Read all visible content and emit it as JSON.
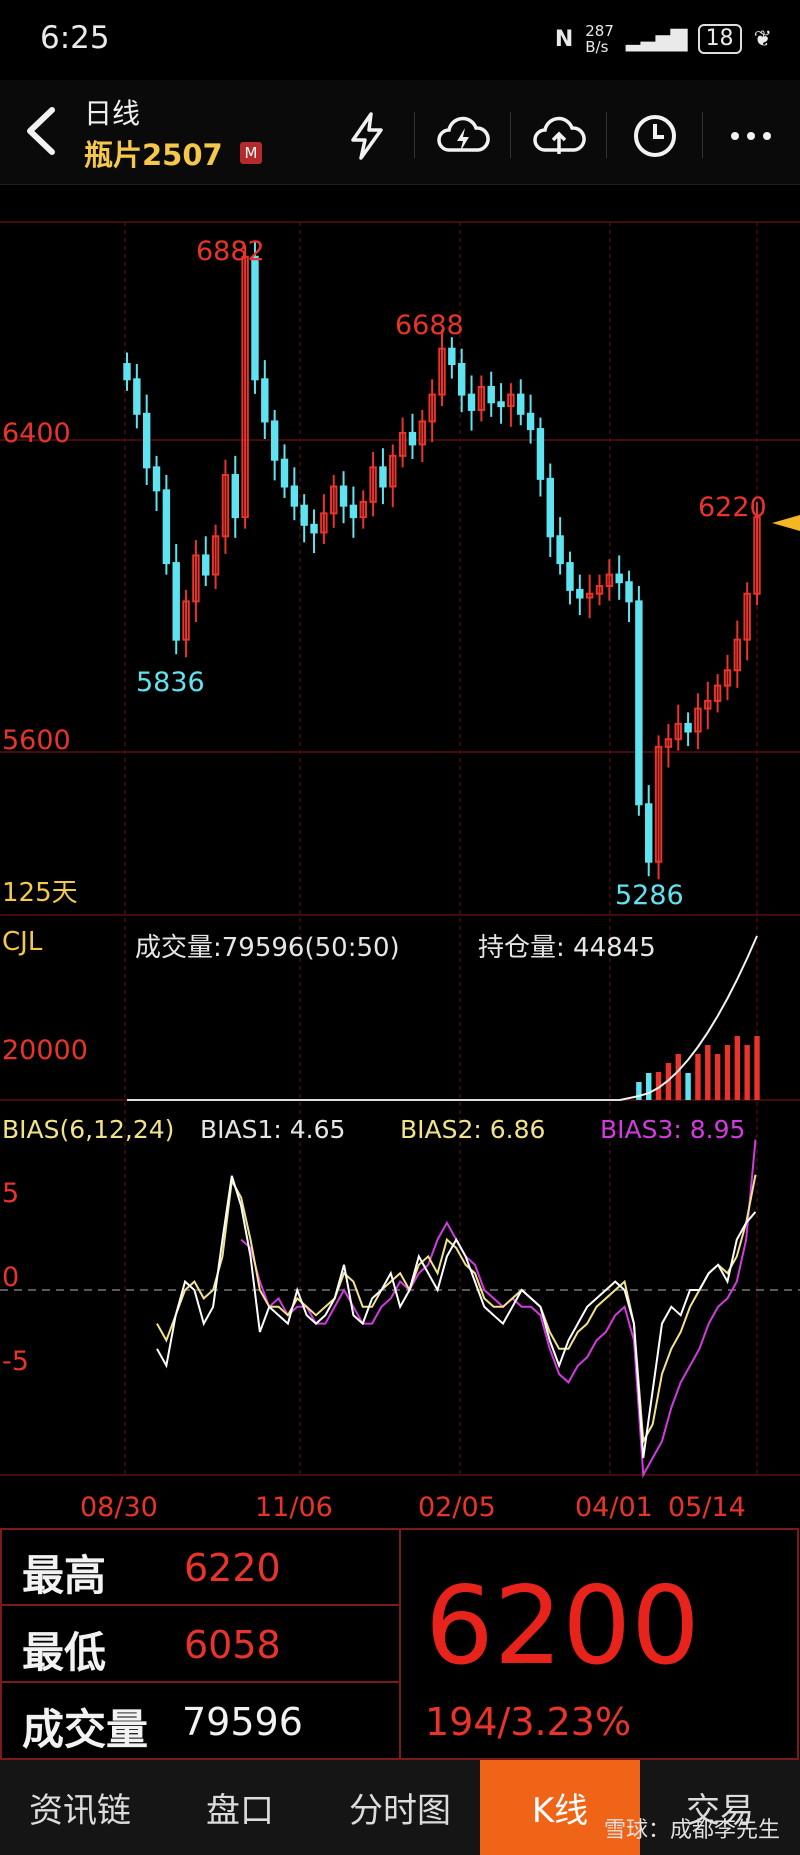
{
  "status": {
    "time": "6:25",
    "net_speed_top": "287",
    "net_speed_bottom": "B/s",
    "battery": "18"
  },
  "nav": {
    "subtitle": "日线",
    "title": "瓶片2507",
    "badge": "M"
  },
  "icons": [
    "back-icon",
    "flash-icon",
    "cloud-flash-icon",
    "cloud-upload-icon",
    "clock-icon",
    "more-icon"
  ],
  "price_panel": {
    "y_labels": [
      "6400",
      "5600"
    ],
    "high_label": "6882",
    "high2_label": "6688",
    "low_label": "5836",
    "low2_label": "5286",
    "last_label": "6220",
    "period": "125天"
  },
  "volume_panel": {
    "name": "CJL",
    "volume_text": "成交量:79596(50:50)",
    "oi_text": "持仓量: 44845",
    "y_label": "20000"
  },
  "bias_panel": {
    "name": "BIAS(6,12,24)",
    "bias1": "BIAS1: 4.65",
    "bias2": "BIAS2: 6.86",
    "bias3": "BIAS3: 8.95",
    "y_labels": [
      "5",
      "0",
      "-5"
    ]
  },
  "x_labels": [
    "08/30",
    "11/06",
    "02/05",
    "04/01",
    "05/14"
  ],
  "colors": {
    "up": "#e8342a",
    "down": "#5fe3f0",
    "bias1": "#ffffff",
    "bias2": "#f2e38a",
    "bias3": "#d23be0",
    "accent": "#f06417"
  },
  "chart_data": {
    "type": "candlestick",
    "panels": [
      "price",
      "volume",
      "bias"
    ],
    "price_range": [
      5200,
      6950
    ],
    "marked": {
      "high": 6882,
      "high2": 6688,
      "low": 5836,
      "low2": 5286,
      "last": 6220
    },
    "closes": [
      6560,
      6470,
      6330,
      6270,
      6080,
      5880,
      5980,
      6100,
      6050,
      6150,
      6310,
      6200,
      6880,
      6560,
      6450,
      6350,
      6280,
      6230,
      6180,
      6160,
      6210,
      6280,
      6230,
      6200,
      6240,
      6330,
      6280,
      6360,
      6420,
      6390,
      6450,
      6520,
      6640,
      6600,
      6520,
      6480,
      6540,
      6500,
      6490,
      6520,
      6470,
      6430,
      6300,
      6150,
      6080,
      6010,
      5990,
      6000,
      6020,
      6050,
      6030,
      5980,
      5450,
      5300,
      5600,
      5620,
      5660,
      5640,
      5700,
      5720,
      5760,
      5800,
      5880,
      6000,
      6200
    ],
    "bias1": [
      -3.5,
      -4.5,
      -1.5,
      0.5,
      0,
      -2,
      -1,
      3,
      6.8,
      5,
      2,
      -2.5,
      -1,
      -1.5,
      -2,
      0,
      -1.5,
      -2,
      -1.5,
      -0.5,
      1.5,
      -1.5,
      -2,
      -0.5,
      0,
      1,
      -1,
      0,
      2,
      1,
      0,
      2,
      3,
      2,
      0.5,
      -1,
      -1.5,
      -2,
      -1,
      0,
      -0.5,
      -1,
      -3,
      -4.5,
      -3,
      -2,
      -1,
      -0.5,
      0,
      0.5,
      0,
      -2,
      -10,
      -6,
      -2,
      -1,
      -1.5,
      0,
      0,
      1,
      1.5,
      0.5,
      3,
      4,
      4.65
    ],
    "bias2": [
      -2,
      -3,
      -1.5,
      0,
      0.5,
      -0.5,
      0,
      2,
      6.5,
      5.5,
      3,
      0,
      -1,
      -1,
      -1.5,
      -0.5,
      -1,
      -1.5,
      -1,
      -0.5,
      1,
      0.5,
      -1,
      -1,
      0,
      0.5,
      1,
      0,
      1.5,
      2,
      1,
      3,
      2.5,
      1.5,
      1,
      -0.5,
      -1,
      -1,
      -0.5,
      0,
      -0.5,
      -1,
      -2.5,
      -3.5,
      -3.5,
      -2.5,
      -2,
      -1,
      -0.5,
      0,
      0.5,
      -2,
      -9,
      -8,
      -5,
      -3.5,
      -2.5,
      -1,
      0,
      1,
      1.5,
      1,
      2,
      4,
      6.86
    ],
    "bias3": [
      null,
      null,
      null,
      null,
      null,
      null,
      null,
      null,
      null,
      3,
      2.5,
      0.5,
      -1,
      -0.5,
      -1.5,
      -1,
      -1,
      -2,
      -2,
      -1,
      0,
      -1,
      -2,
      -2,
      -1,
      -0.5,
      0.5,
      0,
      1,
      1.5,
      3,
      4,
      3,
      2,
      1.5,
      0,
      -0.5,
      -1,
      -0.5,
      -1,
      -1,
      -1.5,
      -3.5,
      -5,
      -5.5,
      -4.5,
      -4,
      -3,
      -2.5,
      -1.5,
      -1,
      -3,
      -11,
      -10,
      -9,
      -7,
      -5.5,
      -4.5,
      -3.5,
      -2,
      -1,
      -0.5,
      0.5,
      3,
      8.95
    ]
  },
  "info": {
    "high_key": "最高",
    "high_val": "6220",
    "low_key": "最低",
    "low_val": "6058",
    "vol_key": "成交量",
    "vol_val": "79596",
    "price": "6200",
    "change": "194/3.23%"
  },
  "tabs": [
    "资讯链",
    "盘口",
    "分时图",
    "K线",
    "交易"
  ],
  "watermark": "雪球：成都李先生"
}
